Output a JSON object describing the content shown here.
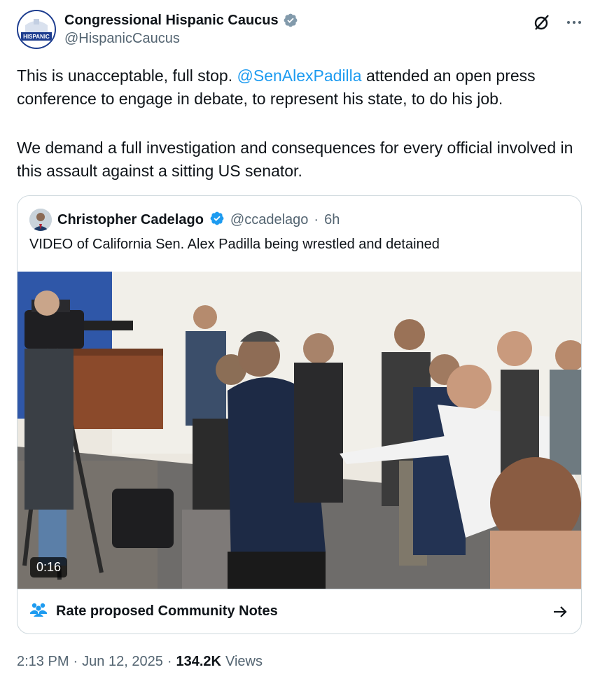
{
  "tweet": {
    "author_name": "Congressional Hispanic Caucus",
    "author_handle": "@HispanicCaucus",
    "avatar_text": "HISPANIC",
    "text_part1": "This is unacceptable, full stop. ",
    "mention": "@SenAlexPadilla",
    "text_part2": " attended an open press conference to engage in debate, to represent his state, to do his job.",
    "text_para2": "We demand a full investigation and consequences for every official involved in this assault against a sitting US senator."
  },
  "quote": {
    "author_name": "Christopher Cadelago",
    "author_handle": "@ccadelago",
    "separator": "·",
    "time": "6h",
    "text": "VIDEO of California Sen. Alex Padilla being wrestled and detained",
    "video_duration": "0:16",
    "community_notes_label": "Rate proposed Community Notes"
  },
  "meta": {
    "time": "2:13 PM",
    "separator1": "·",
    "date": "Jun 12, 2025",
    "separator2": "·",
    "views_count": "134.2K",
    "views_label": "Views"
  },
  "colors": {
    "link": "#1d9bf0",
    "verified_blue": "#1d9bf0",
    "verified_gray": "#829aab",
    "secondary_text": "#536471",
    "border": "#cfd9de"
  },
  "icons": {
    "header_actions": [
      "grok-icon",
      "more-icon"
    ],
    "community_notes": "people-icon",
    "notes_arrow": "arrow-right-icon"
  }
}
